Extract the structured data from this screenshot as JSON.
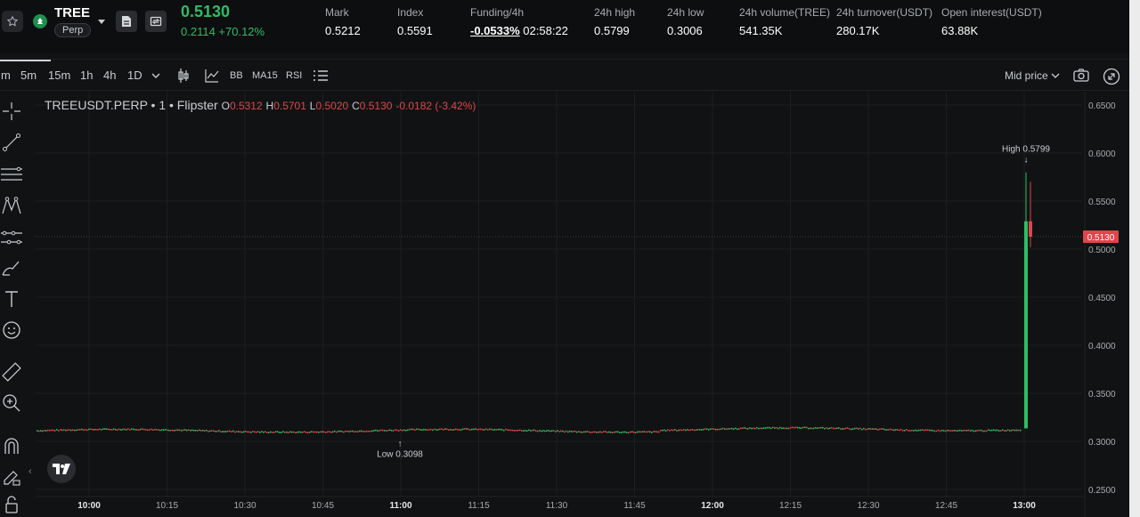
{
  "header": {
    "symbol": "TREE",
    "contract_type": "Perp",
    "last_price": "0.5130",
    "change": "0.2114 +70.12%",
    "stats": [
      {
        "label": "Mark",
        "value": "0.5212"
      },
      {
        "label": "Index",
        "value": "0.5591"
      },
      {
        "label": "Funding/4h",
        "value": "-0.0533%",
        "extra": "02:58:22"
      },
      {
        "label": "24h high",
        "value": "0.5799"
      },
      {
        "label": "24h low",
        "value": "0.3006"
      },
      {
        "label": "24h volume(TREE)",
        "value": "541.35K"
      },
      {
        "label": "24h turnover(USDT)",
        "value": "280.17K"
      },
      {
        "label": "Open interest(USDT)",
        "value": "63.88K"
      }
    ]
  },
  "toolbar": {
    "cut_tab": "m",
    "intervals": [
      "5m",
      "15m",
      "1h",
      "4h",
      "1D"
    ],
    "indicators": [
      "BB",
      "MA15",
      "RSI"
    ],
    "price_source": "Mid price"
  },
  "legend": {
    "title": "TREEUSDT.PERP • 1 • Flipster",
    "o_label": "O",
    "o_value": "0.5312",
    "h_label": "H",
    "h_value": "0.5701",
    "l_label": "L",
    "l_value": "0.5020",
    "c_label": "C",
    "c_value": "0.5130",
    "change": "-0.0182 (-3.42%)"
  },
  "colors": {
    "up": "#2ebd65",
    "down": "#e0454a",
    "bg": "#111213",
    "grid": "#1c1e21"
  },
  "icons": [
    "star-icon",
    "tree-token-icon",
    "chevron-down-icon",
    "document-icon",
    "swap-icon",
    "candlestick-icon",
    "line-chart-icon",
    "list-icon",
    "camera-icon",
    "expand-icon",
    "crosshair-icon",
    "trendline-icon",
    "fib-icon",
    "pattern-icon",
    "forecast-icon",
    "brush-icon",
    "text-icon",
    "emoji-icon",
    "ruler-icon",
    "zoom-in-icon",
    "magnet-icon",
    "lock-icon",
    "tradingview-logo-icon"
  ],
  "chart_data": {
    "type": "candlestick",
    "y_ticks": [
      "0.6500",
      "0.6000",
      "0.5500",
      "0.5000",
      "0.4500",
      "0.4000",
      "0.3500",
      "0.3000",
      "0.2500"
    ],
    "ylim": [
      0.25,
      0.65
    ],
    "x_ticks": [
      "10:00",
      "10:15",
      "10:30",
      "10:45",
      "11:00",
      "11:15",
      "11:30",
      "11:45",
      "12:00",
      "12:15",
      "12:30",
      "12:45",
      "13:00"
    ],
    "bold_x_ticks": [
      "10:00",
      "11:00",
      "12:00",
      "13:00"
    ],
    "baseline_price": 0.311,
    "big_candle": {
      "time": "13:00",
      "open": 0.3135,
      "high": 0.5799,
      "low": 0.3135,
      "close": 0.529
    },
    "last_candle": {
      "time": "13:01",
      "open": 0.529,
      "high": 0.5701,
      "low": 0.502,
      "close": 0.513
    },
    "high_marker": {
      "label": "High 0.5799",
      "value": 0.5799
    },
    "low_marker": {
      "label": "Low 0.3098",
      "value": 0.3098,
      "time": "11:00"
    },
    "last_price_label": "0.5130",
    "last_price_value": 0.513
  }
}
